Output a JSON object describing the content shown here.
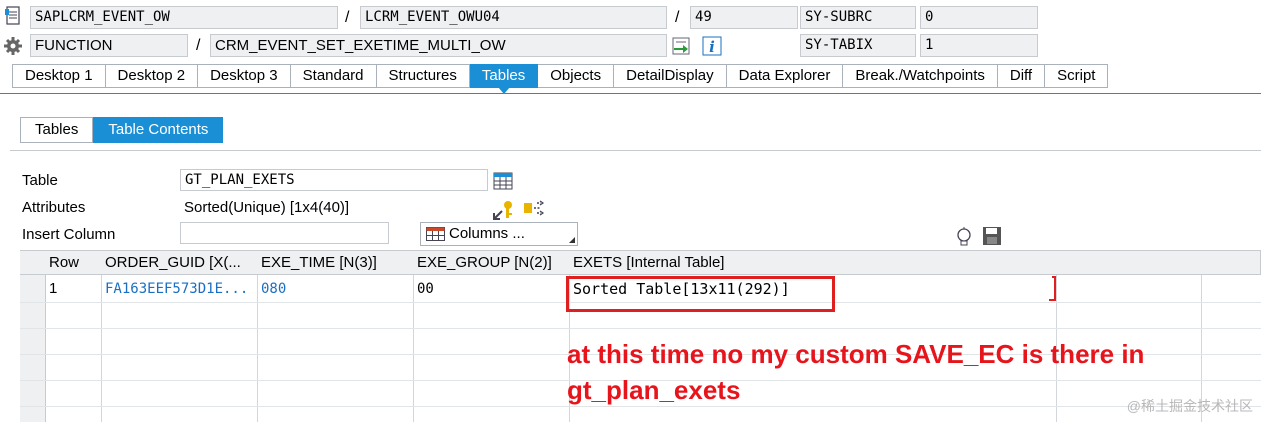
{
  "header": {
    "program": "SAPLCRM_EVENT_OW",
    "include": "LCRM_EVENT_OWU04",
    "line": "49",
    "sy_subrc_label": "SY-SUBRC",
    "sy_subrc_value": "0",
    "type": "FUNCTION",
    "function_name": "CRM_EVENT_SET_EXETIME_MULTI_OW",
    "sy_tabix_label": "SY-TABIX",
    "sy_tabix_value": "1",
    "slash": "/"
  },
  "tabs": [
    "Desktop 1",
    "Desktop 2",
    "Desktop 3",
    "Standard",
    "Structures",
    "Tables",
    "Objects",
    "DetailDisplay",
    "Data Explorer",
    "Break./Watchpoints",
    "Diff",
    "Script"
  ],
  "active_tab": "Tables",
  "subtabs": [
    "Tables",
    "Table Contents"
  ],
  "form": {
    "table_label": "Table",
    "table_value": "GT_PLAN_EXETS",
    "attributes_label": "Attributes",
    "attributes_value": "Sorted(Unique) [1x4(40)]",
    "insert_column_label": "Insert Column",
    "columns_button": "Columns ..."
  },
  "grid": {
    "headers": [
      "Row",
      "ORDER_GUID [X(...",
      "EXE_TIME [N(3)]",
      "EXE_GROUP [N(2)]",
      "EXETS [Internal Table]"
    ],
    "rows": [
      {
        "row": "1",
        "order_guid": "FA163EEF573D1E...",
        "exe_time": "080",
        "exe_group": "00",
        "exets": "Sorted Table[13x11(292)]"
      }
    ]
  },
  "annotation": {
    "line1": "at this time no my custom SAVE_EC is there in",
    "line2": "gt_plan_exets"
  },
  "watermark": "@稀土掘金技术社区",
  "colors": {
    "accent": "#1a8fd6",
    "annotation": "#e8141c"
  }
}
